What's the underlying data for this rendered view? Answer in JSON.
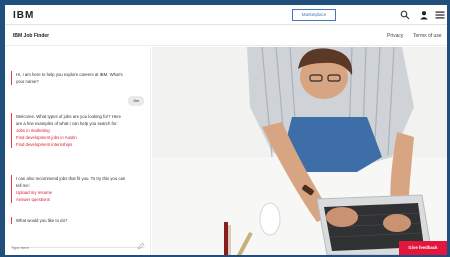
{
  "header": {
    "logo": "IBM",
    "marketplace_label": "Marketplace",
    "icons": [
      "search-icon",
      "user-icon",
      "menu-icon"
    ]
  },
  "subheader": {
    "title": "IBM Job Finder",
    "links": [
      "Privacy",
      "Terms of use"
    ]
  },
  "chat": {
    "messages": [
      {
        "text": "Hi, I am here to help you explore careers at IBM. What's your name?"
      },
      {
        "text": "Welcome. What types of jobs are you looking for? Here are a few examples of what I can help you search for:",
        "options": [
          "Jobs in marketing",
          "Find development jobs in Austin",
          "Find development internships"
        ]
      },
      {
        "text": "I can also recommend jobs that fit you. To try this you can tell me:",
        "options": [
          "Upload my resume",
          "Answer questions"
        ]
      },
      {
        "text": "What would you like to do?"
      }
    ],
    "user_reply": "Jim",
    "input_placeholder": "Type here"
  },
  "feedback_label": "Give feedback",
  "colors": {
    "accent": "#4178be",
    "brand_red": "#e3173e",
    "frame": "#1f4f7a"
  }
}
